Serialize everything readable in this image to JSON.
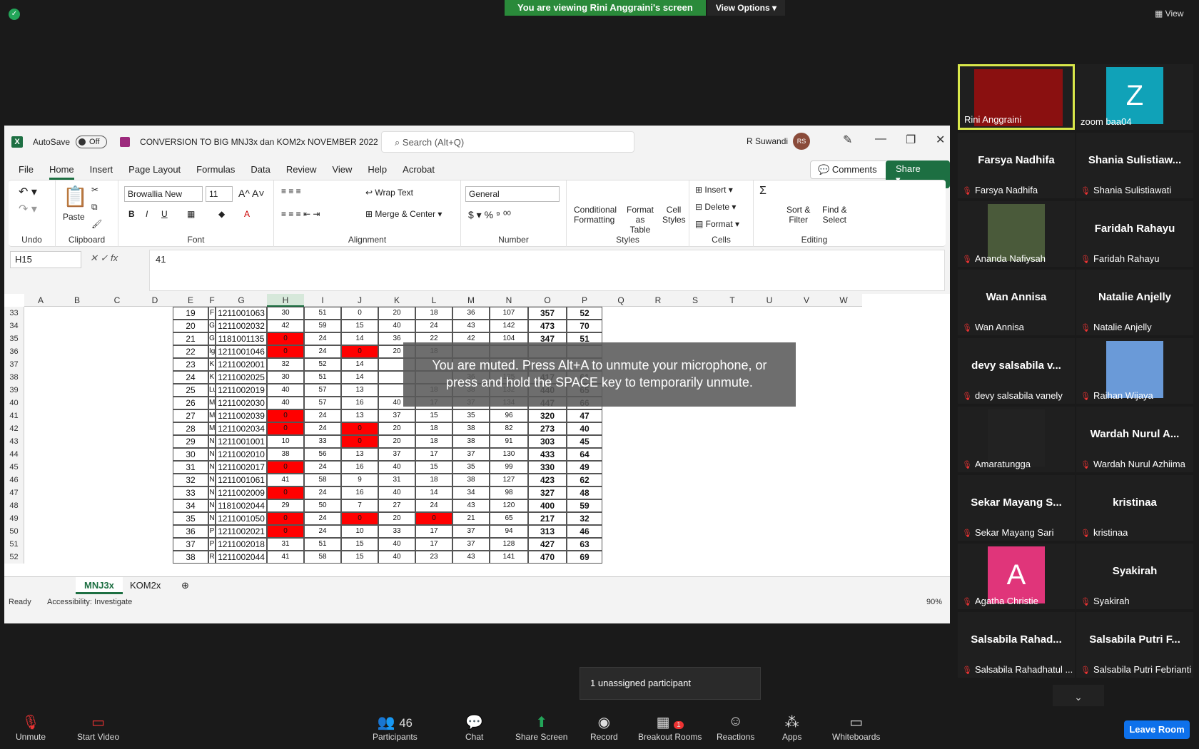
{
  "zoom_top": {
    "viewing": "You are viewing Rini Anggraini's screen",
    "view_options": "View Options",
    "view": "View"
  },
  "excel": {
    "autosave": "AutoSave",
    "toggle": "Off",
    "filename": "CONVERSION TO BIG MNJ3x dan KOM2x NOVEMBER 2022",
    "search_placeholder": "Search (Alt+Q)",
    "user": "R Suwandi",
    "avatar": "RS",
    "menu": [
      "File",
      "Home",
      "Insert",
      "Page Layout",
      "Formulas",
      "Data",
      "Review",
      "View",
      "Help",
      "Acrobat"
    ],
    "comments": "Comments",
    "share": "Share",
    "ribbon": {
      "undo": "Undo",
      "paste": "Paste",
      "clipboard": "Clipboard",
      "font_name": "Browallia New",
      "font_size": "11",
      "font": "Font",
      "wrap": "Wrap Text",
      "merge": "Merge & Center",
      "alignment": "Alignment",
      "number_format": "General",
      "number": "Number",
      "cond1": "Conditional",
      "cond2": "Formatting",
      "fmt1": "Format as",
      "fmt2": "Table",
      "cell1": "Cell",
      "cell2": "Styles",
      "styles": "Styles",
      "insert": "Insert",
      "delete": "Delete",
      "format": "Format",
      "cells": "Cells",
      "sort1": "Sort &",
      "sort2": "Filter",
      "find1": "Find &",
      "find2": "Select",
      "editing": "Editing"
    },
    "namebox": "H15",
    "formula": "41",
    "columns": [
      "A",
      "B",
      "C",
      "D",
      "E",
      "F",
      "G",
      "H",
      "I",
      "J",
      "K",
      "L",
      "M",
      "N",
      "O",
      "P",
      "Q",
      "R",
      "S",
      "T",
      "U",
      "V",
      "W"
    ],
    "rows": [
      {
        "r": "33",
        "e": "19",
        "f": "F",
        "g": "1211001063",
        "h": "30",
        "i": "51",
        "j": "0",
        "k": "20",
        "l": "18",
        "m": "36",
        "n": "107",
        "o": "357",
        "p": "52",
        "red": []
      },
      {
        "r": "34",
        "e": "20",
        "f": "G",
        "g": "1211002032",
        "h": "42",
        "i": "59",
        "j": "15",
        "k": "40",
        "l": "24",
        "m": "43",
        "n": "142",
        "o": "473",
        "p": "70",
        "red": []
      },
      {
        "r": "35",
        "e": "21",
        "f": "G",
        "g": "1181001135",
        "h": "0",
        "i": "24",
        "j": "14",
        "k": "36",
        "l": "22",
        "m": "42",
        "n": "104",
        "o": "347",
        "p": "51",
        "red": [
          "h"
        ]
      },
      {
        "r": "36",
        "e": "22",
        "f": "Ig",
        "g": "1211001046",
        "h": "0",
        "i": "24",
        "j": "0",
        "k": "20",
        "l": "18",
        "m": "",
        "n": "",
        "o": "",
        "p": "",
        "red": [
          "h",
          "j"
        ]
      },
      {
        "r": "37",
        "e": "23",
        "f": "K",
        "g": "1211002001",
        "h": "32",
        "i": "52",
        "j": "14",
        "k": "",
        "l": "",
        "m": "",
        "n": "",
        "o": "",
        "p": "",
        "red": []
      },
      {
        "r": "38",
        "e": "24",
        "f": "K",
        "g": "1211002025",
        "h": "30",
        "i": "51",
        "j": "14",
        "k": "",
        "l": "",
        "m": "36",
        "n": "125",
        "o": "417",
        "p": "61",
        "red": []
      },
      {
        "r": "39",
        "e": "25",
        "f": "Lu",
        "g": "1211002019",
        "h": "40",
        "i": "57",
        "j": "13",
        "k": "",
        "l": "18",
        "m": "38",
        "n": "132",
        "o": "440",
        "p": "65",
        "red": []
      },
      {
        "r": "40",
        "e": "26",
        "f": "M",
        "g": "1211002030",
        "h": "40",
        "i": "57",
        "j": "16",
        "k": "40",
        "l": "17",
        "m": "37",
        "n": "134",
        "o": "447",
        "p": "66",
        "red": []
      },
      {
        "r": "41",
        "e": "27",
        "f": "M",
        "g": "1211002039",
        "h": "0",
        "i": "24",
        "j": "13",
        "k": "37",
        "l": "15",
        "m": "35",
        "n": "96",
        "o": "320",
        "p": "47",
        "red": [
          "h"
        ]
      },
      {
        "r": "42",
        "e": "28",
        "f": "M",
        "g": "1211002034",
        "h": "0",
        "i": "24",
        "j": "0",
        "k": "20",
        "l": "18",
        "m": "38",
        "n": "82",
        "o": "273",
        "p": "40",
        "red": [
          "h",
          "j"
        ]
      },
      {
        "r": "43",
        "e": "29",
        "f": "N",
        "g": "1211001001",
        "h": "10",
        "i": "33",
        "j": "0",
        "k": "20",
        "l": "18",
        "m": "38",
        "n": "91",
        "o": "303",
        "p": "45",
        "red": [
          "j"
        ]
      },
      {
        "r": "44",
        "e": "30",
        "f": "N",
        "g": "1211002010",
        "h": "38",
        "i": "56",
        "j": "13",
        "k": "37",
        "l": "17",
        "m": "37",
        "n": "130",
        "o": "433",
        "p": "64",
        "red": []
      },
      {
        "r": "45",
        "e": "31",
        "f": "N",
        "g": "1211002017",
        "h": "0",
        "i": "24",
        "j": "16",
        "k": "40",
        "l": "15",
        "m": "35",
        "n": "99",
        "o": "330",
        "p": "49",
        "red": [
          "h"
        ]
      },
      {
        "r": "46",
        "e": "32",
        "f": "N",
        "g": "1211001061",
        "h": "41",
        "i": "58",
        "j": "9",
        "k": "31",
        "l": "18",
        "m": "38",
        "n": "127",
        "o": "423",
        "p": "62",
        "red": []
      },
      {
        "r": "47",
        "e": "33",
        "f": "N",
        "g": "1211002009",
        "h": "0",
        "i": "24",
        "j": "16",
        "k": "40",
        "l": "14",
        "m": "34",
        "n": "98",
        "o": "327",
        "p": "48",
        "red": [
          "h"
        ]
      },
      {
        "r": "48",
        "e": "34",
        "f": "N",
        "g": "1181002044",
        "h": "29",
        "i": "50",
        "j": "7",
        "k": "27",
        "l": "24",
        "m": "43",
        "n": "120",
        "o": "400",
        "p": "59",
        "red": []
      },
      {
        "r": "49",
        "e": "35",
        "f": "N",
        "g": "1211001050",
        "h": "0",
        "i": "24",
        "j": "0",
        "k": "20",
        "l": "0",
        "m": "21",
        "n": "65",
        "o": "217",
        "p": "32",
        "red": [
          "h",
          "j",
          "l"
        ]
      },
      {
        "r": "50",
        "e": "36",
        "f": "P",
        "g": "1211002021",
        "h": "0",
        "i": "24",
        "j": "10",
        "k": "33",
        "l": "17",
        "m": "37",
        "n": "94",
        "o": "313",
        "p": "46",
        "red": [
          "h"
        ]
      },
      {
        "r": "51",
        "e": "37",
        "f": "P",
        "g": "1211002018",
        "h": "31",
        "i": "51",
        "j": "15",
        "k": "40",
        "l": "17",
        "m": "37",
        "n": "128",
        "o": "427",
        "p": "63",
        "red": []
      },
      {
        "r": "52",
        "e": "38",
        "f": "R",
        "g": "1211002044",
        "h": "41",
        "i": "58",
        "j": "15",
        "k": "40",
        "l": "23",
        "m": "43",
        "n": "141",
        "o": "470",
        "p": "69",
        "red": []
      }
    ],
    "sheets": [
      "MNJ3x",
      "KOM2x"
    ],
    "status_ready": "Ready",
    "accessibility": "Accessibility: Investigate",
    "zoom": "90%"
  },
  "mute_message": "You are muted. Press Alt+A to unmute your microphone, or press and hold the SPACE key to temporarily unmute.",
  "participants_panel": [
    {
      "name": "Rini Anggraini",
      "big": "",
      "video": "slide",
      "active": true,
      "muted": false
    },
    {
      "name": "zoom baa04",
      "big": "",
      "video": "Z",
      "active": false,
      "muted": false
    },
    {
      "name": "Farsya Nadhifa",
      "big": "Farsya Nadhifa",
      "video": "",
      "active": false,
      "muted": true
    },
    {
      "name": "Shania Sulistiawati",
      "big": "Shania  Sulistiaw...",
      "video": "",
      "active": false,
      "muted": true
    },
    {
      "name": "Ananda Nafiysah",
      "big": "",
      "video": "photo",
      "active": false,
      "muted": true
    },
    {
      "name": "Faridah Rahayu",
      "big": "Faridah Rahayu",
      "video": "",
      "active": false,
      "muted": true
    },
    {
      "name": "Wan Annisa",
      "big": "Wan Annisa",
      "video": "",
      "active": false,
      "muted": true
    },
    {
      "name": "Natalie Anjelly",
      "big": "Natalie Anjelly",
      "video": "",
      "active": false,
      "muted": true
    },
    {
      "name": "devy salsabila vanely",
      "big": "devy salsabila v...",
      "video": "",
      "active": false,
      "muted": true
    },
    {
      "name": "Raihan Wijaya",
      "big": "",
      "video": "sky",
      "active": false,
      "muted": true
    },
    {
      "name": "Amaratungga",
      "big": "",
      "video": "dark",
      "active": false,
      "muted": true
    },
    {
      "name": "Wardah Nurul Azhiima",
      "big": "Wardah  Nurul A...",
      "video": "",
      "active": false,
      "muted": true
    },
    {
      "name": "Sekar Mayang Sari",
      "big": "Sekar Mayang S...",
      "video": "",
      "active": false,
      "muted": true
    },
    {
      "name": "kristinaa",
      "big": "kristinaa",
      "video": "",
      "active": false,
      "muted": true
    },
    {
      "name": "Agatha Christie",
      "big": "",
      "video": "A",
      "active": false,
      "muted": true
    },
    {
      "name": "Syakirah",
      "big": "Syakirah",
      "video": "",
      "active": false,
      "muted": true
    },
    {
      "name": "Salsabila Rahadhatul ...",
      "big": "Salsabila  Rahad...",
      "video": "",
      "active": false,
      "muted": true
    },
    {
      "name": "Salsabila Putri Febrianti",
      "big": "Salsabila  Putri F...",
      "video": "",
      "active": false,
      "muted": true
    }
  ],
  "unassigned": "1 unassigned participant",
  "bottom_bar": {
    "unmute": "Unmute",
    "start_video": "Start Video",
    "participants": "Participants",
    "participants_count": "46",
    "chat": "Chat",
    "share_screen": "Share Screen",
    "record": "Record",
    "breakout": "Breakout Rooms",
    "breakout_badge": "1",
    "reactions": "Reactions",
    "apps": "Apps",
    "whiteboards": "Whiteboards",
    "leave": "Leave Room"
  },
  "colors": {
    "excel_green": "#1d6f42",
    "zoom_green": "#2a8a3a",
    "zoom_blue": "#0e71eb",
    "red_cell": "#ff0000"
  }
}
